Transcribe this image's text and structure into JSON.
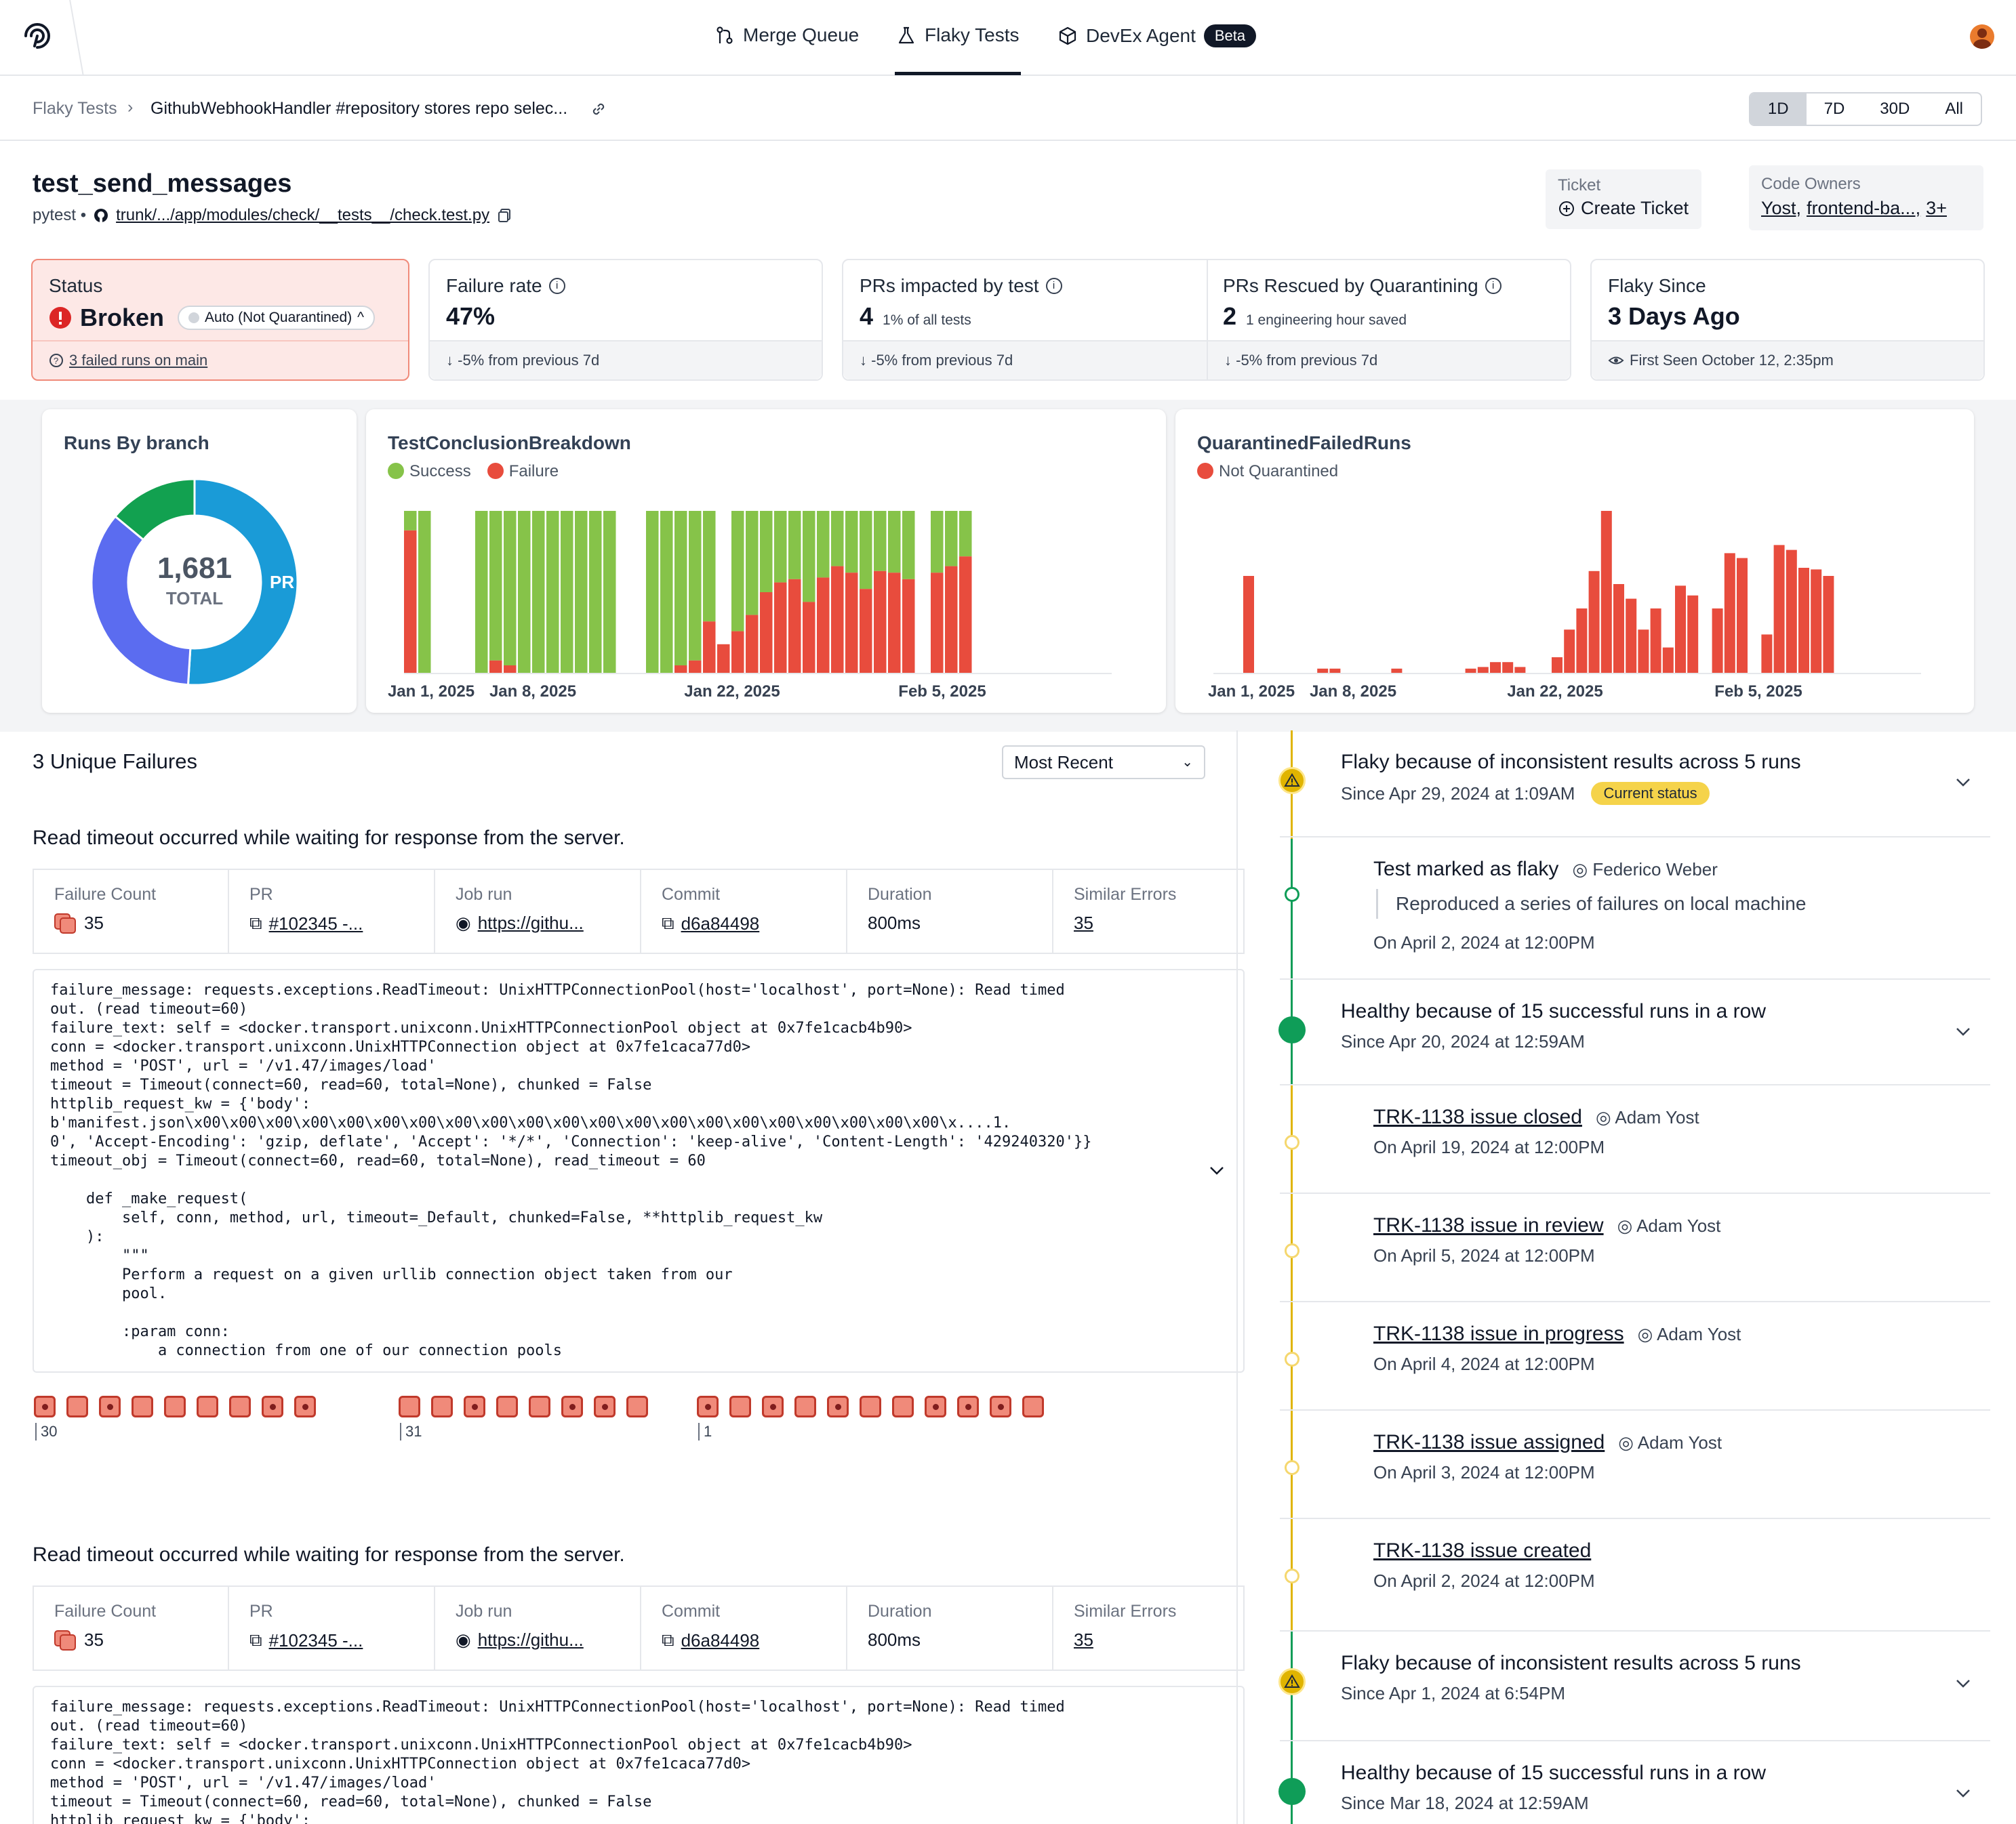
{
  "nav": {
    "tabs": [
      {
        "label": "Merge Queue",
        "icon": "merge-icon"
      },
      {
        "label": "Flaky Tests",
        "icon": "flask-icon",
        "active": true
      },
      {
        "label": "DevEx Agent",
        "icon": "cube-icon",
        "badge": "Beta"
      }
    ]
  },
  "breadcrumb": {
    "root": "Flaky Tests",
    "current": "GithubWebhookHandler #repository stores repo selec...",
    "ranges": [
      "1D",
      "7D",
      "30D",
      "All"
    ],
    "active_range": "1D"
  },
  "test": {
    "name": "test_send_messages",
    "framework": "pytest •",
    "path": "trunk/.../app/modules/check/__tests__/check.test.py",
    "ticket_label": "Ticket",
    "create_ticket": "Create Ticket",
    "owners_label": "Code Owners",
    "owners": [
      "Yost,",
      "frontend-ba...,",
      "3+"
    ]
  },
  "stats": {
    "status": {
      "label": "Status",
      "value": "Broken",
      "pill": "Auto (Not Quarantined)",
      "foot": "3 failed runs on main"
    },
    "failure_rate": {
      "label": "Failure rate",
      "value": "47%",
      "foot": "-5% from previous 7d"
    },
    "prs_impacted": {
      "label": "PRs impacted by test",
      "value": "4",
      "sub": "1% of all tests",
      "foot": "-5% from previous 7d"
    },
    "prs_rescued": {
      "label": "PRs Rescued by Quarantining",
      "value": "2",
      "sub": "1 engineering hour saved",
      "foot": "-5% from previous 7d"
    },
    "flaky_since": {
      "label": "Flaky Since",
      "value": "3 Days Ago",
      "foot": "First Seen October 12, 2:35pm"
    }
  },
  "chart_data": [
    {
      "type": "pie",
      "title": "Runs By branch",
      "center_value": "1,681",
      "center_label": "TOTAL",
      "slices": [
        {
          "name": "PR",
          "value": 0.51,
          "color": "#1a9bd7",
          "labeled": true
        },
        {
          "name": "",
          "value": 0.35,
          "color": "#5b6cf0"
        },
        {
          "name": "",
          "value": 0.14,
          "color": "#12a150"
        }
      ]
    },
    {
      "type": "bar",
      "title": "TestConclusionBreakdown",
      "series_names": [
        "Success",
        "Failure"
      ],
      "colors": {
        "success": "#86c349",
        "failure": "#e84c3d"
      },
      "x_ticks": [
        "Jan 1, 2025",
        "Jan 8, 2025",
        "Jan 22, 2025",
        "Feb 5, 2025"
      ],
      "tick_index": [
        0,
        5,
        17,
        29
      ],
      "max": 100,
      "failure": [
        88,
        0,
        0,
        0,
        0,
        0,
        8,
        5,
        0,
        0,
        0,
        0,
        0,
        0,
        0,
        0,
        0,
        0,
        0,
        5,
        8,
        32,
        18,
        26,
        36,
        50,
        56,
        58,
        44,
        59,
        66,
        62,
        52,
        63,
        62,
        58,
        0,
        62,
        66,
        72
      ],
      "success": [
        12,
        100,
        0,
        0,
        0,
        100,
        92,
        95,
        100,
        100,
        100,
        100,
        100,
        100,
        100,
        0,
        0,
        100,
        100,
        95,
        92,
        68,
        0,
        74,
        64,
        50,
        44,
        42,
        56,
        41,
        34,
        38,
        48,
        37,
        38,
        42,
        0,
        38,
        34,
        28
      ]
    },
    {
      "type": "bar",
      "title": "QuarantinedFailedRuns",
      "series_names": [
        "Not Quarantined"
      ],
      "color": "#e84c3d",
      "x_ticks": [
        "Jan 1, 2025",
        "Jan 8, 2025",
        "Jan 22, 2025",
        "Feb 5, 2025"
      ],
      "tick_index": [
        0,
        5,
        17,
        29
      ],
      "max": 100,
      "values": [
        60,
        0,
        0,
        0,
        0,
        0,
        3,
        3,
        0,
        0,
        0,
        0,
        3,
        0,
        0,
        0,
        0,
        0,
        3,
        4,
        7,
        7,
        4,
        0,
        0,
        10,
        27,
        40,
        63,
        100,
        55,
        46,
        27,
        40,
        16,
        54,
        48,
        0,
        40,
        74,
        71,
        0,
        24,
        79,
        76,
        65,
        64,
        60
      ]
    }
  ],
  "failures": {
    "title": "3 Unique Failures",
    "sort": "Most Recent",
    "items": [
      {
        "heading": "Read timeout occurred while waiting for response from the server.",
        "meta": [
          {
            "label": "Failure Count",
            "value": "35"
          },
          {
            "label": "PR",
            "value": "#102345 -..."
          },
          {
            "label": "Job run",
            "value": "https://githu..."
          },
          {
            "label": "Commit",
            "value": "d6a84498"
          },
          {
            "label": "Duration",
            "value": "800ms"
          },
          {
            "label": "Similar Errors",
            "value": "35"
          }
        ],
        "log": "failure_message: requests.exceptions.ReadTimeout: UnixHTTPConnectionPool(host='localhost', port=None): Read timed\nout. (read timeout=60)\nfailure_text: self = <docker.transport.unixconn.UnixHTTPConnectionPool object at 0x7fe1cacb4b90>\nconn = <docker.transport.unixconn.UnixHTTPConnection object at 0x7fe1caca77d0>\nmethod = 'POST', url = '/v1.47/images/load'\ntimeout = Timeout(connect=60, read=60, total=None), chunked = False\nhttplib_request_kw = {'body':\nb'manifest.json\\x00\\x00\\x00\\x00\\x00\\x00\\x00\\x00\\x00\\x00\\x00\\x00\\x00\\x00\\x00\\x00\\x00\\x00\\x00\\x00\\x00\\x....1.\n0', 'Accept-Encoding': 'gzip, deflate', 'Accept': '*/*', 'Connection': 'keep-alive', 'Content-Length': '429240320'}}\ntimeout_obj = Timeout(connect=60, read=60, total=None), read_timeout = 60\n\n    def _make_request(\n        self, conn, method, url, timeout=_Default, chunked=False, **httplib_request_kw\n    ):\n        \"\"\"\n        Perform a request on a given urllib connection object taken from our\n        pool.\n\n        :param conn:\n            a connection from one of our connection pools",
        "groups": [
          {
            "label": "30",
            "dots": [
              1,
              0,
              1,
              0,
              0,
              0,
              0,
              1,
              1
            ]
          },
          {
            "label": "31",
            "dots": [
              0,
              0,
              1,
              0,
              0,
              1,
              1,
              0
            ]
          },
          {
            "label": "1",
            "dots": [
              1,
              0,
              1,
              0,
              1,
              0,
              0,
              1,
              1,
              1,
              0
            ]
          }
        ]
      },
      {
        "heading": "Read timeout occurred while waiting for response from the server.",
        "meta": [
          {
            "label": "Failure Count",
            "value": "35"
          },
          {
            "label": "PR",
            "value": "#102345 -..."
          },
          {
            "label": "Job run",
            "value": "https://githu..."
          },
          {
            "label": "Commit",
            "value": "d6a84498"
          },
          {
            "label": "Duration",
            "value": "800ms"
          },
          {
            "label": "Similar Errors",
            "value": "35"
          }
        ],
        "log": "failure_message: requests.exceptions.ReadTimeout: UnixHTTPConnectionPool(host='localhost', port=None): Read timed\nout. (read timeout=60)\nfailure_text: self = <docker.transport.unixconn.UnixHTTPConnectionPool object at 0x7fe1cacb4b90>\nconn = <docker.transport.unixconn.UnixHTTPConnection object at 0x7fe1caca77d0>\nmethod = 'POST', url = '/v1.47/images/load'\ntimeout = Timeout(connect=60, read=60, total=None), chunked = False\nhttplib_request_kw = {'body':"
      }
    ]
  },
  "timeline": [
    {
      "kind": "status",
      "icon": "warning-icon",
      "title": "Flaky because of inconsistent results across 5 runs",
      "sub": "Since Apr 29, 2024 at 1:09AM",
      "badge": "Current status"
    },
    {
      "kind": "event",
      "icon": "ring",
      "title": "Test marked as flaky",
      "person": "Federico Weber",
      "quote": "Reproduced a series of failures on local machine",
      "sub": "On April 2, 2024 at 12:00PM"
    },
    {
      "kind": "status",
      "icon": "healthy-icon",
      "title": "Healthy because of 15 successful runs in a row",
      "sub": "Since Apr 20, 2024 at 12:59AM"
    },
    {
      "kind": "event",
      "icon": "ring-yellow",
      "title": "TRK-1138 issue closed",
      "person": "Adam Yost",
      "sub": "On April 19, 2024 at 12:00PM",
      "link": true
    },
    {
      "kind": "event",
      "icon": "ring-yellow",
      "title": "TRK-1138 issue in review",
      "person": "Adam Yost",
      "sub": "On April 5, 2024 at 12:00PM",
      "link": true
    },
    {
      "kind": "event",
      "icon": "ring-yellow",
      "title": "TRK-1138 issue in progress",
      "person": "Adam Yost",
      "sub": "On April 4, 2024 at 12:00PM",
      "link": true
    },
    {
      "kind": "event",
      "icon": "ring-yellow",
      "title": "TRK-1138 issue assigned",
      "person": "Adam Yost",
      "sub": "On April 3, 2024 at 12:00PM",
      "link": true
    },
    {
      "kind": "event",
      "icon": "ring-yellow",
      "title": "TRK-1138 issue created",
      "sub": "On April 2, 2024 at 12:00PM",
      "link": true
    },
    {
      "kind": "status",
      "icon": "warning-icon",
      "title": "Flaky because of inconsistent results across 5 runs",
      "sub": "Since Apr 1, 2024 at 6:54PM"
    },
    {
      "kind": "status",
      "icon": "healthy-icon",
      "title": "Healthy because of 15 successful runs in a row",
      "sub": "Since Mar 18, 2024 at 12:59AM"
    }
  ],
  "colors": {
    "accent": "#111827",
    "failure": "#e84c3d",
    "success": "#86c349",
    "warning": "#e0b400",
    "healthy": "#0f9d58"
  }
}
